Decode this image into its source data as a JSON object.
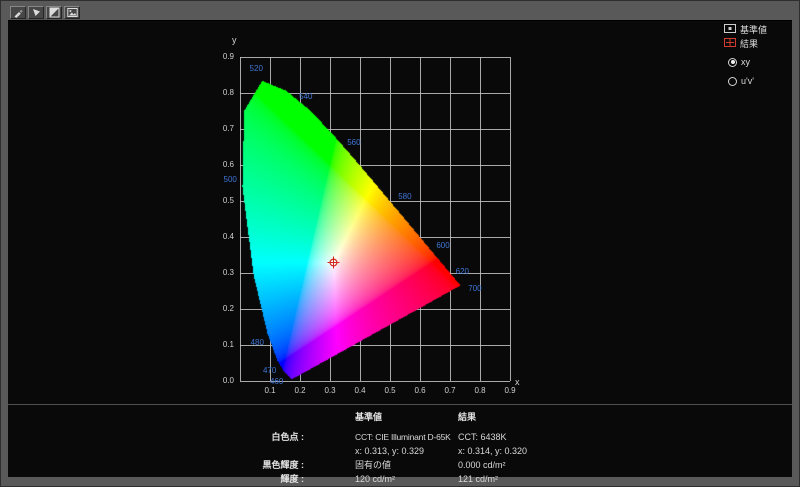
{
  "window": {
    "frame_color": "#595959",
    "panel_color": "#090909"
  },
  "toolbar": {
    "buttons": [
      {
        "icon": "eyedropper-icon"
      },
      {
        "icon": "marker-triangle-icon"
      },
      {
        "icon": "contrast-icon"
      },
      {
        "icon": "image-icon"
      }
    ]
  },
  "legend": {
    "reference_label": "基準値",
    "result_label": "結果",
    "radios": [
      {
        "label": "xy",
        "selected": true
      },
      {
        "label": "u'v'",
        "selected": false
      }
    ]
  },
  "chart_data": {
    "type": "chromaticity-diagram",
    "color_space": "CIE 1931 xy",
    "xlabel": "x",
    "ylabel": "y",
    "xlim": [
      0,
      0.9
    ],
    "ylim": [
      0,
      0.9
    ],
    "grid": true,
    "x_ticks": [
      "0.1",
      "0.2",
      "0.3",
      "0.4",
      "0.5",
      "0.6",
      "0.7",
      "0.8",
      "0.9"
    ],
    "y_ticks": [
      "0.9",
      "0.8",
      "0.7",
      "0.6",
      "0.5",
      "0.4",
      "0.3",
      "0.2",
      "0.1",
      "0.0"
    ],
    "wavelength_labels": [
      "460",
      "470",
      "480",
      "500",
      "520",
      "540",
      "560",
      "580",
      "600",
      "620",
      "700"
    ],
    "wavelength_label_color": "#4076d6",
    "white_point": {
      "x": 0.313,
      "y": 0.329,
      "marker": "circle-cross",
      "color": "#d42a1e"
    },
    "spectral_locus": [
      [
        380,
        0.1741,
        0.005
      ],
      [
        390,
        0.1738,
        0.0049
      ],
      [
        400,
        0.1733,
        0.0048
      ],
      [
        410,
        0.1726,
        0.0048
      ],
      [
        420,
        0.1714,
        0.0051
      ],
      [
        430,
        0.1689,
        0.0069
      ],
      [
        440,
        0.1644,
        0.0109
      ],
      [
        450,
        0.1566,
        0.0177
      ],
      [
        460,
        0.144,
        0.0297
      ],
      [
        470,
        0.1241,
        0.0578
      ],
      [
        480,
        0.0913,
        0.1327
      ],
      [
        490,
        0.0454,
        0.295
      ],
      [
        500,
        0.0082,
        0.5384
      ],
      [
        510,
        0.0139,
        0.7502
      ],
      [
        520,
        0.0743,
        0.8338
      ],
      [
        530,
        0.1547,
        0.8059
      ],
      [
        540,
        0.2296,
        0.7543
      ],
      [
        550,
        0.3016,
        0.6923
      ],
      [
        560,
        0.3731,
        0.6245
      ],
      [
        570,
        0.4441,
        0.5547
      ],
      [
        580,
        0.5125,
        0.4866
      ],
      [
        590,
        0.5752,
        0.4242
      ],
      [
        600,
        0.627,
        0.3725
      ],
      [
        610,
        0.6658,
        0.334
      ],
      [
        620,
        0.6915,
        0.3083
      ],
      [
        630,
        0.7079,
        0.292
      ],
      [
        640,
        0.719,
        0.2809
      ],
      [
        650,
        0.726,
        0.274
      ],
      [
        660,
        0.73,
        0.27
      ],
      [
        670,
        0.732,
        0.268
      ],
      [
        680,
        0.7334,
        0.2666
      ],
      [
        690,
        0.7344,
        0.2656
      ],
      [
        700,
        0.7347,
        0.2653
      ]
    ]
  },
  "results": {
    "header_reference": "基準値",
    "header_result": "結果",
    "white_point_row": {
      "label": "白色点 :",
      "ref_cct": "CCT: CIE Illuminant D-65K",
      "ref_xy": "x: 0.313, y: 0.329",
      "res_cct": "CCT: 6438K",
      "res_xy": "x: 0.314, y: 0.320"
    },
    "black_level_row": {
      "label": "黒色輝度 :",
      "ref": "固有の値",
      "res": "0.000 cd/m²"
    },
    "luminance_row": {
      "label": "輝度 :",
      "ref": "120 cd/m²",
      "res": "121 cd/m²"
    }
  }
}
